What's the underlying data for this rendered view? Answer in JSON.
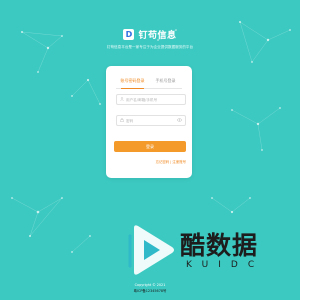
{
  "colors": {
    "background": "#3cc9c1",
    "accent": "#f08a24",
    "button": "#f39a2b",
    "logo_blue": "#2f6fe0"
  },
  "brand": {
    "logo_icon": "brand-logo-icon",
    "logo_letter": "D",
    "name": "钉苟信息"
  },
  "tagline": "钉苟信息平台是一家专注于为企业提供数据服务的平台",
  "login": {
    "tabs": [
      {
        "label": "账号密码登录",
        "active": true
      },
      {
        "label": "手机号登录",
        "active": false
      }
    ],
    "username": {
      "icon": "user-icon",
      "placeholder": "用户名/邮箱/手机号",
      "value": ""
    },
    "password": {
      "icon": "lock-icon",
      "placeholder": "密码",
      "value": "",
      "toggle_icon": "eye-icon"
    },
    "submit_label": "登录",
    "links_text": "忘记密码 | 注册账号"
  },
  "footer": {
    "copyright": "Copyright © 2021",
    "beian": "粤ICP备12345678号"
  },
  "watermark": {
    "cn_text": "酷数据",
    "en_text": "KUIDC",
    "icon": "play-logo-icon"
  }
}
